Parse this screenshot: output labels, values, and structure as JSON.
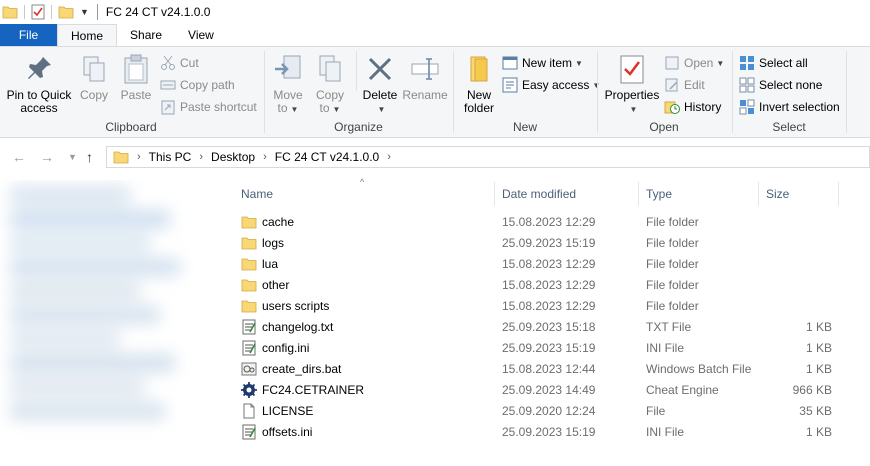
{
  "window": {
    "title": "FC 24 CT v24.1.0.0"
  },
  "tabs": {
    "file": "File",
    "home": "Home",
    "share": "Share",
    "view": "View"
  },
  "ribbon": {
    "clipboard": {
      "label": "Clipboard",
      "pin_line1": "Pin to Quick",
      "pin_line2": "access",
      "copy": "Copy",
      "paste": "Paste",
      "cut": "Cut",
      "copy_path": "Copy path",
      "paste_shortcut": "Paste shortcut"
    },
    "organize": {
      "label": "Organize",
      "move_line1": "Move",
      "move_line2": "to",
      "copy_line1": "Copy",
      "copy_line2": "to",
      "delete": "Delete",
      "rename": "Rename"
    },
    "new": {
      "label": "New",
      "folder_line1": "New",
      "folder_line2": "folder",
      "new_item": "New item",
      "easy_access": "Easy access"
    },
    "open": {
      "label": "Open",
      "properties": "Properties",
      "open": "Open",
      "edit": "Edit",
      "history": "History"
    },
    "select": {
      "label": "Select",
      "select_all": "Select all",
      "select_none": "Select none",
      "invert": "Invert selection"
    }
  },
  "address": {
    "crumbs": [
      "This PC",
      "Desktop",
      "FC 24 CT v24.1.0.0"
    ]
  },
  "columns": {
    "name": "Name",
    "date": "Date modified",
    "type": "Type",
    "size": "Size"
  },
  "files": [
    {
      "name": "cache",
      "date": "15.08.2023 12:29",
      "type": "File folder",
      "size": "",
      "icon": "folder-icon"
    },
    {
      "name": "logs",
      "date": "25.09.2023 15:19",
      "type": "File folder",
      "size": "",
      "icon": "folder-icon"
    },
    {
      "name": "lua",
      "date": "15.08.2023 12:29",
      "type": "File folder",
      "size": "",
      "icon": "folder-icon"
    },
    {
      "name": "other",
      "date": "15.08.2023 12:29",
      "type": "File folder",
      "size": "",
      "icon": "folder-icon"
    },
    {
      "name": "users scripts",
      "date": "15.08.2023 12:29",
      "type": "File folder",
      "size": "",
      "icon": "folder-icon"
    },
    {
      "name": "changelog.txt",
      "date": "25.09.2023 15:18",
      "type": "TXT File",
      "size": "1 KB",
      "icon": "text-file-icon"
    },
    {
      "name": "config.ini",
      "date": "25.09.2023 15:19",
      "type": "INI File",
      "size": "1 KB",
      "icon": "ini-file-icon"
    },
    {
      "name": "create_dirs.bat",
      "date": "15.08.2023 12:44",
      "type": "Windows Batch File",
      "size": "1 KB",
      "icon": "batch-file-icon"
    },
    {
      "name": "FC24.CETRAINER",
      "date": "25.09.2023 14:49",
      "type": "Cheat Engine",
      "size": "966 KB",
      "icon": "cheat-engine-icon"
    },
    {
      "name": "LICENSE",
      "date": "25.09.2020 12:24",
      "type": "File",
      "size": "35 KB",
      "icon": "blank-file-icon"
    },
    {
      "name": "offsets.ini",
      "date": "25.09.2023 15:19",
      "type": "INI File",
      "size": "1 KB",
      "icon": "ini-file-icon"
    }
  ],
  "colors": {
    "accent": "#1565c0",
    "folder": "#f8d775",
    "header_text": "#4c607a"
  }
}
